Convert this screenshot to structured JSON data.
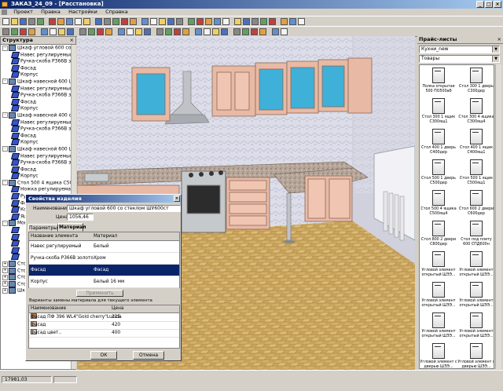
{
  "window": {
    "title": "ЗАКАЗ_24_09 - [Расстановка]",
    "min": "_",
    "max": "□",
    "close": "×"
  },
  "menu": [
    "Проект",
    "Правка",
    "Настройки",
    "Справка"
  ],
  "structure": {
    "title": "Структура",
    "items": [
      {
        "text": "Шкаф угловой 600 со стекл",
        "level": 0,
        "exp": "-"
      },
      {
        "text": "Навес регулируемый",
        "level": 1
      },
      {
        "text": "Ручка-скоба Р366В золо",
        "level": 1
      },
      {
        "text": "Фасад",
        "level": 1
      },
      {
        "text": "Корпус",
        "level": 1
      },
      {
        "text": "Шкаф навесной 600 ШН600с",
        "level": 0,
        "exp": "-"
      },
      {
        "text": "Навес регулируемый",
        "level": 1
      },
      {
        "text": "Ручка-скоба Р366В золо",
        "level": 1
      },
      {
        "text": "Фасад",
        "level": 1
      },
      {
        "text": "Корпус",
        "level": 1
      },
      {
        "text": "Шкаф навесной 400 со стекл",
        "level": 0,
        "exp": "-"
      },
      {
        "text": "Навес регулируемый",
        "level": 1
      },
      {
        "text": "Ручка-скоба Р366В золо",
        "level": 1
      },
      {
        "text": "Фасад",
        "level": 1
      },
      {
        "text": "Корпус",
        "level": 1
      },
      {
        "text": "Шкаф навесной 600 ШН600с",
        "level": 0,
        "exp": "-"
      },
      {
        "text": "Навес регулируемый",
        "level": 1
      },
      {
        "text": "Ручка-скоба Р366В золо",
        "level": 1
      },
      {
        "text": "Фасад",
        "level": 1
      },
      {
        "text": "Корпус",
        "level": 1
      },
      {
        "text": "Стол 500 4 ящика С500ящ4",
        "level": 0,
        "exp": "-"
      },
      {
        "text": "Ножка регулируемая 10",
        "level": 1
      },
      {
        "text": "Ручка-скоба Р366В золо",
        "level": 1
      },
      {
        "text": "Фасад",
        "level": 1
      },
      {
        "text": "Корпус",
        "level": 1
      },
      {
        "text": "Ящик",
        "level": 1
      },
      {
        "text": "Мойка",
        "level": 0,
        "exp": "-"
      },
      {
        "text": "",
        "level": 1
      },
      {
        "text": "",
        "level": 1
      },
      {
        "text": "",
        "level": 1
      },
      {
        "text": "",
        "level": 1
      },
      {
        "text": "",
        "level": 1
      },
      {
        "text": "Стол",
        "level": 0,
        "exp": "+"
      },
      {
        "text": "Стол",
        "level": 0,
        "exp": "+"
      },
      {
        "text": "Стол",
        "level": 0,
        "exp": "+"
      },
      {
        "text": "Стол",
        "level": 0,
        "exp": "+"
      },
      {
        "text": "Шка",
        "level": 0,
        "exp": "+"
      }
    ]
  },
  "dialog": {
    "title": "Свойства изделия",
    "name_label": "Наименование",
    "name_value": "Шкаф угловой 600 со стеклом ШУ600ст",
    "price_label": "Цена",
    "price_value": "1056,46",
    "tabs": [
      "Параметры",
      "Материал"
    ],
    "cols": [
      "Название элемента",
      "Материал"
    ],
    "rows": [
      {
        "name": "Навес регулируемый",
        "mat": "Белый",
        "selected": false
      },
      {
        "name": "Ручка-скоба Р366В золото",
        "mat": "Хром",
        "selected": false
      },
      {
        "name": "Фасад",
        "mat": "Фасад",
        "selected": true
      },
      {
        "name": "Корпус",
        "mat": "Белый 16 мм",
        "selected": false
      }
    ],
    "replace_btn": "Применить",
    "variants_label": "Варианты замены материала для текущего элемента",
    "vcols": [
      "Наименование",
      "Цена"
    ],
    "variants": [
      {
        "name": "Фасад ПФ 396 WL4\"Gold cherry\"Lucida",
        "price": "325",
        "color": "#c87a44"
      },
      {
        "name": "Фасад",
        "price": "420",
        "color": "#d9b89a"
      },
      {
        "name": "Фасад цвет..",
        "price": "400",
        "color": "#e8d8c8"
      }
    ],
    "ok": "ОК",
    "cancel": "Отмена"
  },
  "pricelists": {
    "title": "Прайс-листы",
    "combo1": "Кухни_new",
    "combo2": "Товары",
    "items": [
      "Полка открытая 500 ПО500аб",
      "Стол 300 1 дверь С300дер",
      "Стол 300 1 ящик С300ящ1",
      "Стол 300 4 ящика С300ящ4",
      "Стол 400 1 дверь С400дер",
      "Стол 400 1 ящик С400ящ1",
      "Стол 500 1 дверь С500дер",
      "Стол 500 1 ящик С500ящ1",
      "Стол 500 4 ящика С500ящ4",
      "Стол 600 2 двери С600дер",
      "Стол 800 2 двери С800дер",
      "Стол под плиту 600 СПД600н",
      "Угловой элемент открытый ШЭЭ...",
      "Угловой элемент открытый ШЭЭ...",
      "Угловой элемент открытый ШЭЭ...",
      "Угловой элемент открытый ШЭЭ...",
      "Угловой элемент открытый ШЭЭ...",
      "Угловой элемент открытый ШЭЭ...",
      "Угловой элемент с дверью ШЭЭ...",
      "Угловой элемент с дверью ШЭЭ..."
    ]
  },
  "status": {
    "value": "17981,03"
  },
  "colors": {
    "titlebar": "#0a246a",
    "selection": "#0a246a",
    "chrome": "#d4d0c8",
    "facade": "#e8b9a4",
    "glass": "#3fb0d8"
  }
}
